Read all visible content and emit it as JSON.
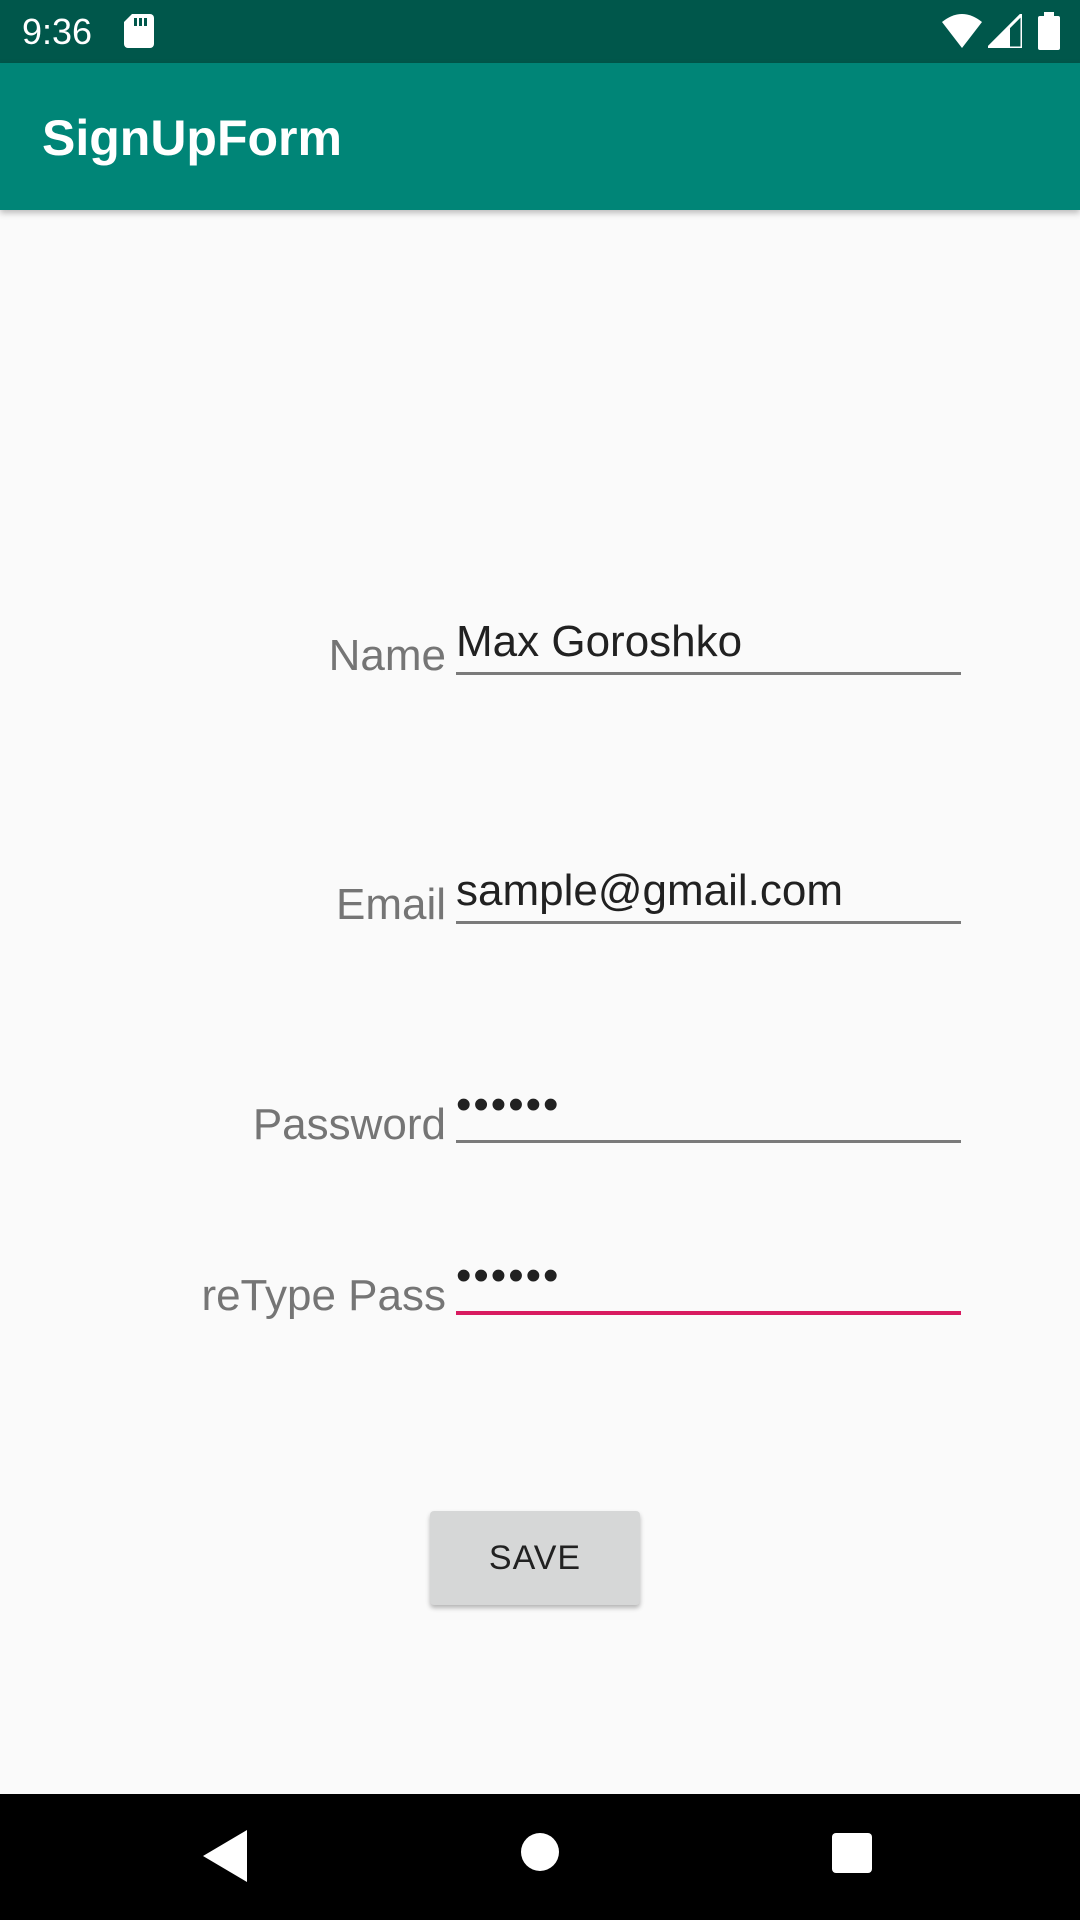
{
  "status_bar": {
    "time": "9:36",
    "icons": [
      "sd-card-icon",
      "wifi-icon",
      "signal-icon",
      "battery-icon"
    ]
  },
  "app_bar": {
    "title": "SignUpForm",
    "color": "#008577"
  },
  "form": {
    "name": {
      "label": "Name",
      "value": "Max Goroshko"
    },
    "email": {
      "label": "Email",
      "value": "sample@gmail.com"
    },
    "password": {
      "label": "Password",
      "value": "••••••"
    },
    "retype": {
      "label": "reType Pass",
      "value": "••••••",
      "focused": true
    }
  },
  "save_button": {
    "label": "SAVE"
  },
  "colors": {
    "status_bar": "#00574B",
    "accent": "#D81B60",
    "background": "#FAFAFA"
  },
  "nav_bar": {
    "icons": [
      "back-icon",
      "home-icon",
      "recent-apps-icon"
    ]
  }
}
